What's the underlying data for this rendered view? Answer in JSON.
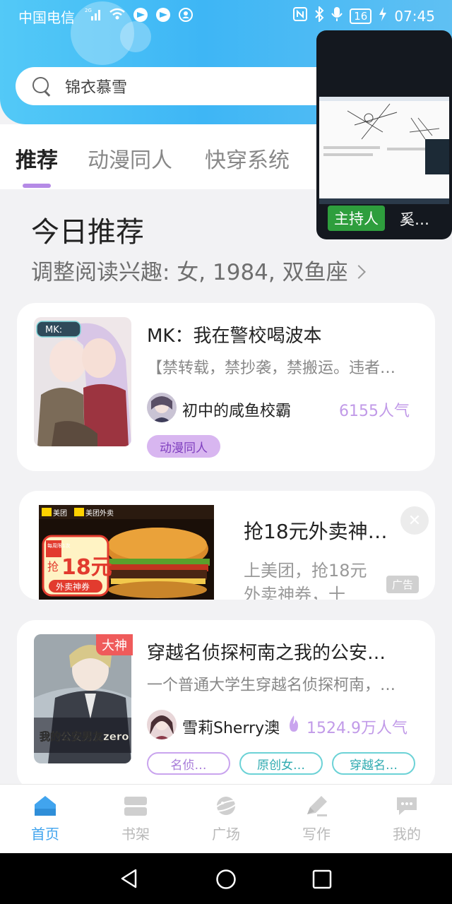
{
  "status_bar": {
    "carrier": "中国电信",
    "network": "2G",
    "battery": "16",
    "time": "07:45"
  },
  "search": {
    "text": "锦衣慕雪"
  },
  "tabs": [
    {
      "label": "推荐",
      "active": true
    },
    {
      "label": "动漫同人",
      "active": false
    },
    {
      "label": "快穿系统",
      "active": false
    }
  ],
  "section": {
    "title": "今日推荐",
    "interest": "调整阅读兴趣: 女, 1984, 双鱼座"
  },
  "books": [
    {
      "title": "MK：我在警校喝波本",
      "description": "【禁转载，禁抄袭，禁搬运。违者…",
      "author": "初中的咸鱼校霸",
      "popularity": "6155人气",
      "tags": [
        "动漫同人"
      ],
      "cover_label": "MK:"
    },
    {
      "title": "穿越名侦探柯南之我的公安…",
      "description": "一个普通大学生穿越名侦探柯南，…",
      "author": "雪莉Sherry澳",
      "popularity": "1524.9万人气",
      "badge": "大神",
      "tags": [
        "名侦…",
        "原创女…",
        "穿越名…"
      ],
      "cover_text": "我的公安男友zero"
    }
  ],
  "ad": {
    "title": "抢18元外卖神…",
    "subtitle_line1": "上美团，抢18元",
    "subtitle_line2": "外卖神券，十",
    "label": "广告",
    "banner_brand1": "美团",
    "banner_brand2": "美团外卖",
    "banner_amount": "18元",
    "banner_grab": "抢",
    "banner_coupon": "外卖神券",
    "banner_limit": "每周限1次"
  },
  "pip": {
    "host_label": "主持人",
    "name": "奚…"
  },
  "bottom_nav": [
    {
      "label": "首页",
      "active": true
    },
    {
      "label": "书架",
      "active": false
    },
    {
      "label": "广场",
      "active": false
    },
    {
      "label": "写作",
      "active": false
    },
    {
      "label": "我的",
      "active": false
    }
  ],
  "colors": {
    "accent_blue": "#41a4ee",
    "accent_purple": "#b58ae6",
    "header_blue": "#3eb6f5"
  }
}
